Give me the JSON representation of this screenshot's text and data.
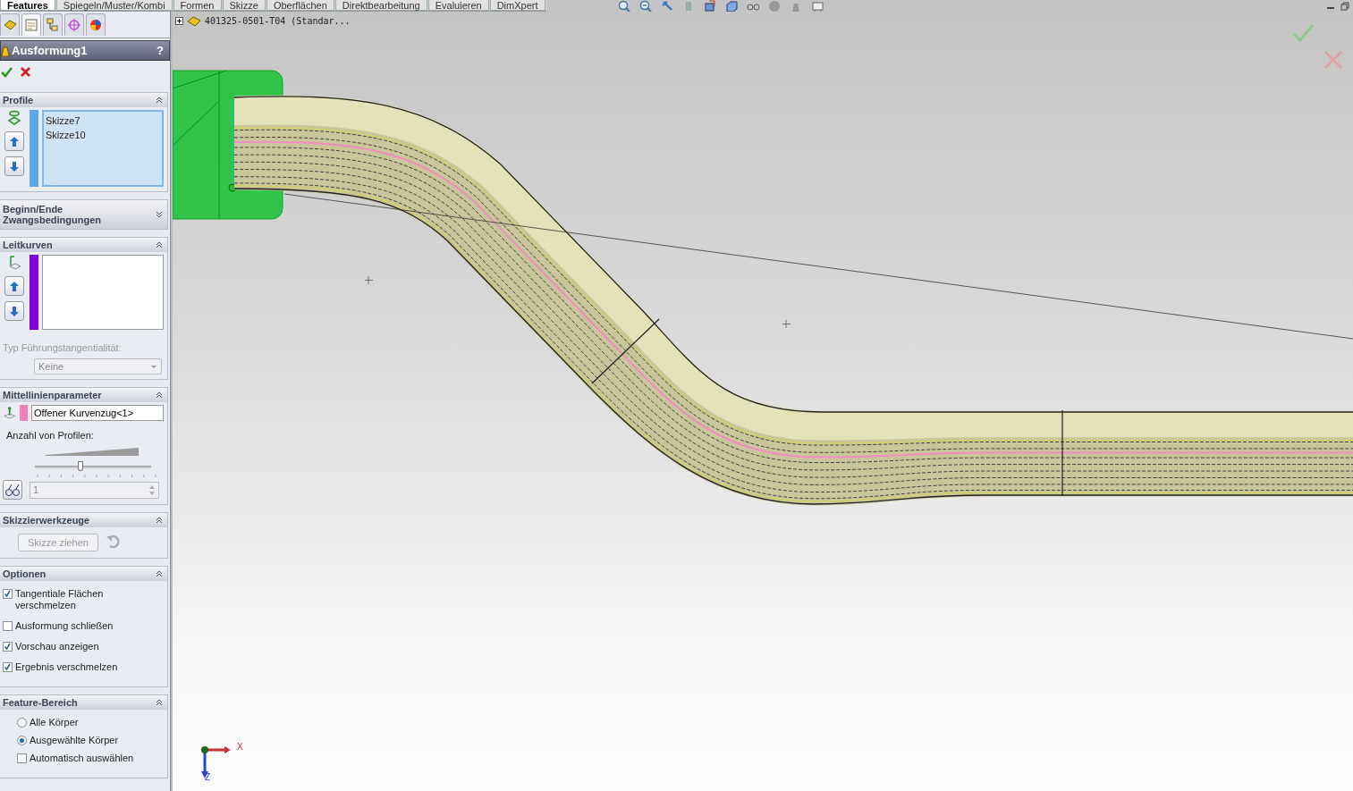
{
  "command_tabs": [
    {
      "label": "Features",
      "selected": true
    },
    {
      "label": "Spiegeln/Muster/Kombi",
      "selected": false
    },
    {
      "label": "Formen",
      "selected": false
    },
    {
      "label": "Skizze",
      "selected": false
    },
    {
      "label": "Oberflächen",
      "selected": false
    },
    {
      "label": "Direktbearbeitung",
      "selected": false
    },
    {
      "label": "Evaluieren",
      "selected": false
    },
    {
      "label": "DimXpert",
      "selected": false
    }
  ],
  "panel_tabs": [
    {
      "selected": false
    },
    {
      "selected": true
    },
    {
      "selected": false
    },
    {
      "selected": false
    },
    {
      "selected": false
    }
  ],
  "panel": {
    "title": "Ausformung1",
    "help": "?"
  },
  "sections": [
    {
      "kind": "profiles",
      "title": "Profile",
      "expanded": true,
      "color": "#5aa8f0",
      "items": [
        "Skizze7",
        "Skizze10"
      ]
    },
    {
      "kind": "constraints",
      "title": "Beginn/Ende Zwangsbedingungen",
      "expanded": false
    },
    {
      "kind": "guides",
      "title": "Leitkurven",
      "expanded": true,
      "color": "#8000e0",
      "tangency_label": "Typ Führungstangentialität:",
      "tangency_value": "Keine",
      "disabled": true
    },
    {
      "kind": "centerline",
      "title": "Mittellinienparameter",
      "expanded": true,
      "color": "#f080b8",
      "value": "Offener Kurvenzug<1>",
      "count_label": "Anzahl von Profilen:",
      "level": 0.39,
      "count": "1",
      "disabled": true
    },
    {
      "kind": "tools",
      "title": "Skizzierwerkzeuge",
      "expanded": true,
      "button": "Skizze ziehen",
      "disabled": true
    },
    {
      "kind": "options",
      "title": "Optionen",
      "expanded": true,
      "items": [
        {
          "kind": "checkbox",
          "label": "Tangentiale Flächen verschmelzen",
          "checked": true
        },
        {
          "kind": "checkbox",
          "label": "Ausformung schließen",
          "checked": false
        },
        {
          "kind": "checkbox",
          "label": "Vorschau anzeigen",
          "checked": true
        },
        {
          "kind": "checkbox",
          "label": "Ergebnis verschmelzen",
          "checked": true
        }
      ]
    },
    {
      "kind": "options",
      "title": "Feature-Bereich",
      "expanded": true,
      "items": [
        {
          "kind": "radio",
          "label": "Alle Körper",
          "selected": false
        },
        {
          "kind": "radio",
          "label": "Ausgewählte Körper",
          "selected": true
        },
        {
          "kind": "checkbox",
          "label": "Automatisch auswählen",
          "checked": false
        }
      ]
    }
  ],
  "viewport": {
    "tree_label": "401325-0501-T04  (Standar...",
    "axis_x": "X",
    "axis_z": "Z"
  }
}
